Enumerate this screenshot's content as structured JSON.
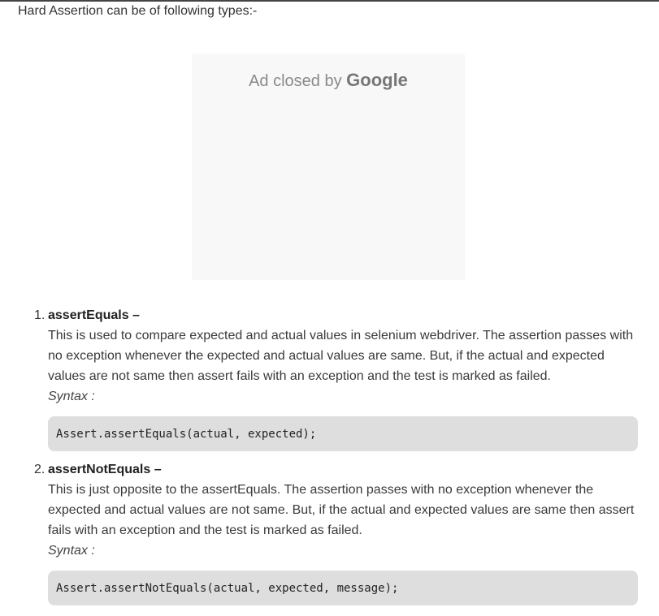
{
  "intro_text": "Hard Assertion can be of following types:-",
  "ad": {
    "prefix": "Ad closed by ",
    "brand": "Google"
  },
  "items": [
    {
      "number": "1.",
      "title": "assertEquals –",
      "description": "This is used to compare expected and actual values in selenium webdriver. The assertion passes with no exception whenever the expected and actual values are same. But, if the actual and expected values are not same then assert fails with an exception and the test is marked as failed.",
      "syntax_label": "Syntax :",
      "code": "Assert.assertEquals(actual, expected);"
    },
    {
      "number": "2.",
      "title": "assertNotEquals –",
      "description": "This is just opposite to the assertEquals. The assertion passes with no exception whenever the expected and actual values are not same. But, if the actual and expected values are same then assert fails with an exception and the test is marked as failed.",
      "syntax_label": "Syntax :",
      "code": "Assert.assertNotEquals(actual, expected, message);"
    }
  ]
}
